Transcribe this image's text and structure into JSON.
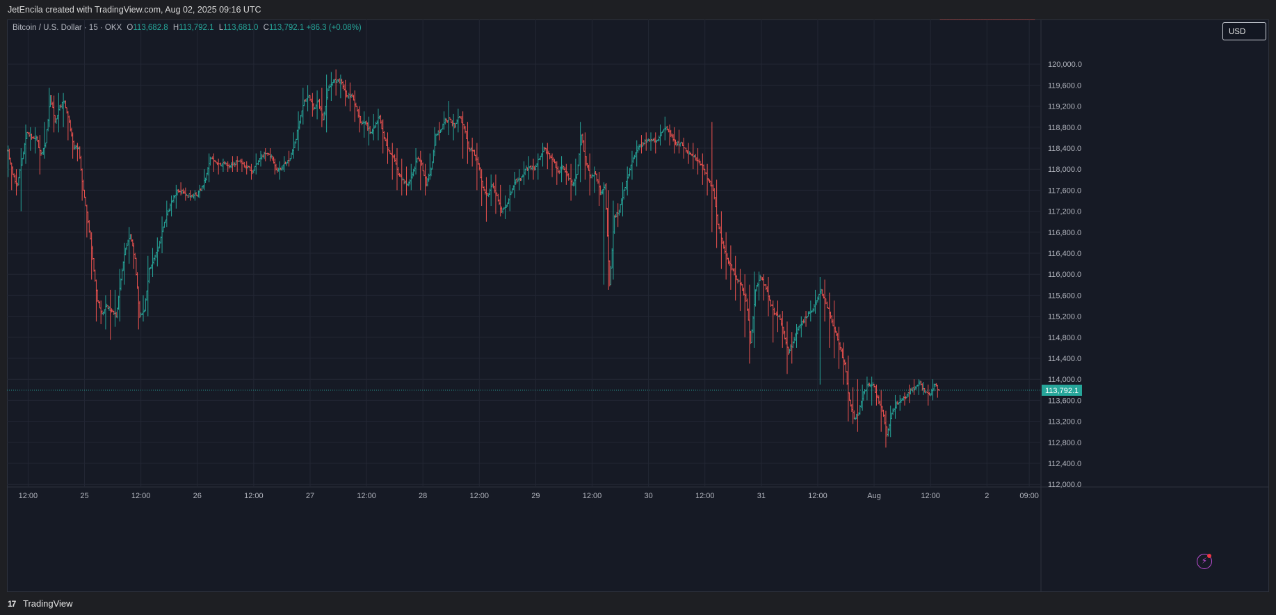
{
  "header": {
    "attribution": "JetEncila created with TradingView.com, Aug 02, 2025 09:16 UTC"
  },
  "legend": {
    "symbol": "Bitcoin / U.S. Dollar · 15 · OKX",
    "open_label": "O",
    "open": "113,682.8",
    "high_label": "H",
    "high": "113,792.1",
    "low_label": "L",
    "low": "113,681.0",
    "close_label": "C",
    "close": "113,792.1",
    "change": "+86.3 (+0.08%)"
  },
  "currency_button": "USD",
  "footer": {
    "logo": "17",
    "brand": "TradingView"
  },
  "colors": {
    "up": "#26a69a",
    "down": "#ef5350",
    "background": "#161a25",
    "grid": "#232734",
    "axis_text": "#b2b5be",
    "last_price_label": "#26a69a",
    "alert_icon": "#c04fd8"
  },
  "icons": {
    "alert": "lightning-bolt-icon",
    "logo": "tradingview-logo-icon"
  },
  "chart_data": {
    "type": "line",
    "style": "ohlc-bars",
    "interval_minutes": 15,
    "x_tick_labels": [
      "12:00",
      "25",
      "12:00",
      "26",
      "12:00",
      "27",
      "12:00",
      "28",
      "12:00",
      "29",
      "12:00",
      "30",
      "12:00",
      "31",
      "12:00",
      "Aug",
      "12:00",
      "2",
      "09:00"
    ],
    "x_ticks_hours": [
      0,
      12,
      24,
      36,
      48,
      60,
      72,
      84,
      96,
      108,
      120,
      132,
      144,
      156,
      168,
      180,
      192,
      204,
      213
    ],
    "x_range_hours": [
      -4.5,
      215.5
    ],
    "y_ticks": [
      112000,
      112400,
      112800,
      113200,
      113600,
      114000,
      114400,
      114800,
      115200,
      115600,
      116000,
      116400,
      116800,
      117200,
      117600,
      118000,
      118400,
      118800,
      119200,
      119600,
      120000
    ],
    "y_tick_labels": [
      "112,000.0",
      "112,400.0",
      "112,800.0",
      "113,200.0",
      "113,600.0",
      "114,000.0",
      "114,400.0",
      "114,800.0",
      "115,200.0",
      "115,600.0",
      "116,000.0",
      "116,400.0",
      "116,800.0",
      "117,200.0",
      "117,600.0",
      "118,000.0",
      "118,400.0",
      "118,800.0",
      "119,200.0",
      "119,600.0",
      "120,000.0"
    ],
    "ylim": [
      111950,
      120850
    ],
    "last_price": 113792.1,
    "last_price_label": "113,792.1",
    "grid": true,
    "series": [
      {
        "x_hours": [
          -4.5,
          -4,
          -3,
          -2,
          -1,
          0,
          1,
          2,
          3,
          4,
          5,
          6,
          7,
          8,
          9,
          10,
          11,
          12,
          13,
          14,
          15,
          16,
          17,
          18,
          19,
          20,
          21,
          22,
          23,
          24,
          25,
          26,
          27,
          28,
          29,
          30,
          31,
          32,
          33,
          34,
          35,
          36,
          37,
          38,
          39,
          40,
          41,
          42,
          43,
          44,
          45,
          46,
          47,
          48,
          49,
          50,
          51,
          52,
          53,
          54,
          55,
          56,
          57,
          58,
          59,
          60,
          61,
          62,
          63,
          64,
          65,
          66,
          67,
          68,
          69,
          70,
          71,
          72,
          73,
          74,
          75,
          76,
          77,
          78,
          79,
          80,
          81,
          82,
          83,
          84,
          85,
          86,
          87,
          88,
          89,
          90,
          91,
          92,
          93,
          94,
          95,
          96,
          97,
          98,
          99,
          100,
          101,
          102,
          103,
          104,
          105,
          106,
          107,
          108,
          109,
          110,
          111,
          112,
          113,
          114,
          115,
          116,
          117,
          118,
          119,
          120,
          121,
          122,
          123,
          124,
          125,
          126,
          127,
          128,
          129,
          130,
          131,
          132,
          133,
          134,
          135,
          136,
          137,
          138,
          139,
          140,
          141,
          142,
          143,
          144,
          145,
          146,
          147,
          148,
          149,
          150,
          151,
          152,
          153,
          154,
          155,
          156,
          157,
          158,
          159,
          160,
          161,
          162,
          163,
          164,
          165,
          166,
          167,
          168,
          169,
          170,
          171,
          172,
          173,
          174,
          175,
          176,
          177,
          178,
          179,
          180,
          181,
          182,
          183,
          184,
          185,
          186,
          187,
          188,
          189,
          190,
          191,
          192,
          193,
          194,
          195,
          196,
          197,
          198,
          199,
          200,
          201,
          202,
          203,
          204,
          205,
          206,
          207,
          208,
          209,
          210,
          211,
          212,
          213,
          214
        ],
        "close": [
          118350,
          117900,
          117700,
          118200,
          118700,
          118600,
          118600,
          118300,
          118500,
          119400,
          118900,
          119200,
          119300,
          118900,
          118400,
          118400,
          117600,
          117000,
          116300,
          115500,
          115250,
          115400,
          115300,
          115200,
          115900,
          116500,
          116750,
          116300,
          115200,
          115300,
          116100,
          116300,
          116500,
          116900,
          117200,
          117400,
          117600,
          117600,
          117500,
          117500,
          117500,
          117600,
          117800,
          118200,
          118150,
          118100,
          118100,
          118050,
          118100,
          118150,
          118100,
          118050,
          117950,
          118100,
          118250,
          118300,
          118250,
          118000,
          118000,
          118100,
          118200,
          118500,
          118900,
          119300,
          119400,
          119150,
          119300,
          118950,
          119500,
          119650,
          119700,
          119650,
          119400,
          119400,
          119200,
          118900,
          118900,
          118700,
          118800,
          119000,
          118600,
          118350,
          118250,
          117900,
          117800,
          117700,
          117900,
          118200,
          118100,
          117700,
          118000,
          118650,
          118750,
          118950,
          118950,
          118800,
          119000,
          118800,
          118400,
          118350,
          118100,
          117650,
          117500,
          117700,
          117500,
          117200,
          117300,
          117550,
          117800,
          117800,
          118000,
          118050,
          118000,
          118200,
          118400,
          118300,
          118150,
          117950,
          118050,
          117900,
          117700,
          117900,
          118650,
          118100,
          117850,
          117900,
          117550,
          117700,
          115800,
          117100,
          117200,
          117600,
          117900,
          118200,
          118400,
          118500,
          118550,
          118550,
          118550,
          118700,
          118800,
          118650,
          118500,
          118500,
          118400,
          118300,
          118250,
          118150,
          118000,
          117800,
          117600,
          116950,
          116600,
          116300,
          116100,
          115900,
          115800,
          115500,
          114700,
          115700,
          115950,
          115800,
          115500,
          115250,
          115200,
          114900,
          114500,
          114700,
          114950,
          115100,
          115200,
          115300,
          115500,
          115700,
          115450,
          115200,
          114900,
          114600,
          114300,
          113600,
          113250,
          113350,
          113750,
          113900,
          113900,
          113650,
          113400,
          112950,
          113350,
          113550,
          113600,
          113650,
          113800,
          113850,
          113950,
          113750,
          113700,
          113900,
          113792.1
        ],
        "high": [
          118450,
          118100,
          118000,
          118400,
          118850,
          118800,
          118800,
          118650,
          118900,
          119550,
          119400,
          119450,
          119450,
          119100,
          118700,
          118500,
          118000,
          117300,
          116800,
          115900,
          115500,
          115600,
          115700,
          115700,
          116100,
          116600,
          116900,
          116600,
          115700,
          115600,
          116350,
          116500,
          116700,
          117100,
          117400,
          117500,
          117700,
          117750,
          117650,
          117600,
          117600,
          117700,
          118000,
          118300,
          118300,
          118200,
          118200,
          118150,
          118250,
          118250,
          118200,
          118150,
          118100,
          118300,
          118350,
          118400,
          118400,
          118200,
          118150,
          118250,
          118350,
          118700,
          119100,
          119550,
          119600,
          119450,
          119500,
          119550,
          119800,
          119850,
          119900,
          119800,
          119700,
          119650,
          119500,
          119200,
          119100,
          119000,
          119050,
          119150,
          118950,
          118700,
          118500,
          118400,
          118200,
          118050,
          118100,
          118400,
          118350,
          118100,
          118300,
          118800,
          118900,
          119100,
          119300,
          119050,
          119150,
          119100,
          118900,
          118600,
          118500,
          118000,
          117850,
          117900,
          117900,
          117700,
          117500,
          117700,
          117950,
          118000,
          118150,
          118250,
          118200,
          118300,
          118500,
          118500,
          118300,
          118150,
          118250,
          118100,
          118100,
          118200,
          118900,
          118700,
          118300,
          118050,
          117950,
          117750,
          117600,
          117400,
          117350,
          117750,
          118050,
          118350,
          118550,
          118650,
          118700,
          118700,
          118700,
          118850,
          119000,
          118850,
          118800,
          118750,
          118600,
          118500,
          118500,
          118400,
          118300,
          118100,
          118900,
          117800,
          117200,
          116800,
          116550,
          116350,
          116100,
          116000,
          115800,
          116050,
          116050,
          116000,
          115950,
          115500,
          115500,
          115300,
          115100,
          114900,
          115050,
          115200,
          115300,
          115500,
          115700,
          115950,
          115900,
          115650,
          115500,
          115000,
          114700,
          114450,
          113850,
          114000,
          113900,
          114050,
          114050,
          113900,
          113800,
          113400,
          113500,
          113700,
          113700,
          113750,
          113900,
          114000,
          114000,
          113950,
          113900,
          114000,
          113800
        ],
        "low": [
          117850,
          117600,
          117500,
          117200,
          118100,
          118350,
          118300,
          117900,
          118200,
          118800,
          118700,
          118700,
          118800,
          118550,
          118200,
          118150,
          117400,
          116700,
          115900,
          115100,
          115050,
          114950,
          114750,
          115000,
          115100,
          115800,
          116200,
          116100,
          114950,
          115100,
          115200,
          115950,
          116150,
          116400,
          116900,
          117100,
          117250,
          117500,
          117400,
          117400,
          117400,
          117450,
          117600,
          117750,
          117950,
          117900,
          117950,
          117950,
          117950,
          117950,
          117950,
          117900,
          117800,
          117900,
          118050,
          118150,
          118150,
          117900,
          117800,
          117950,
          118050,
          118200,
          118350,
          118850,
          119100,
          119000,
          118950,
          118800,
          118700,
          119300,
          119400,
          119350,
          119200,
          119100,
          118900,
          118700,
          118600,
          118450,
          118550,
          118550,
          118300,
          118100,
          117800,
          117600,
          117500,
          117500,
          117600,
          117900,
          117600,
          117500,
          117800,
          118250,
          118550,
          118750,
          118650,
          118550,
          118700,
          118200,
          118100,
          118050,
          117600,
          117300,
          117000,
          117300,
          117150,
          117100,
          117050,
          117200,
          117450,
          117600,
          117700,
          117800,
          117800,
          117800,
          118050,
          118000,
          117850,
          117700,
          117750,
          117700,
          117400,
          117500,
          117750,
          117800,
          117500,
          117550,
          117300,
          115800,
          115700,
          115900,
          116900,
          117100,
          117500,
          117800,
          118050,
          118300,
          118350,
          118350,
          118300,
          118450,
          118550,
          118450,
          118300,
          118300,
          118200,
          118100,
          118000,
          117900,
          117700,
          117500,
          116800,
          116500,
          116100,
          115900,
          115700,
          115500,
          115300,
          114800,
          114300,
          114600,
          115500,
          115500,
          115200,
          114700,
          114900,
          114600,
          114100,
          114300,
          114600,
          114800,
          115000,
          115100,
          115250,
          113900,
          115100,
          114600,
          114400,
          114200,
          113900,
          113200,
          113150,
          113000,
          113400,
          113600,
          113500,
          113500,
          113000,
          112700,
          112900,
          113250,
          113400,
          113500,
          113550,
          113700,
          113700,
          113700,
          113500,
          113600,
          113650
        ]
      }
    ]
  }
}
